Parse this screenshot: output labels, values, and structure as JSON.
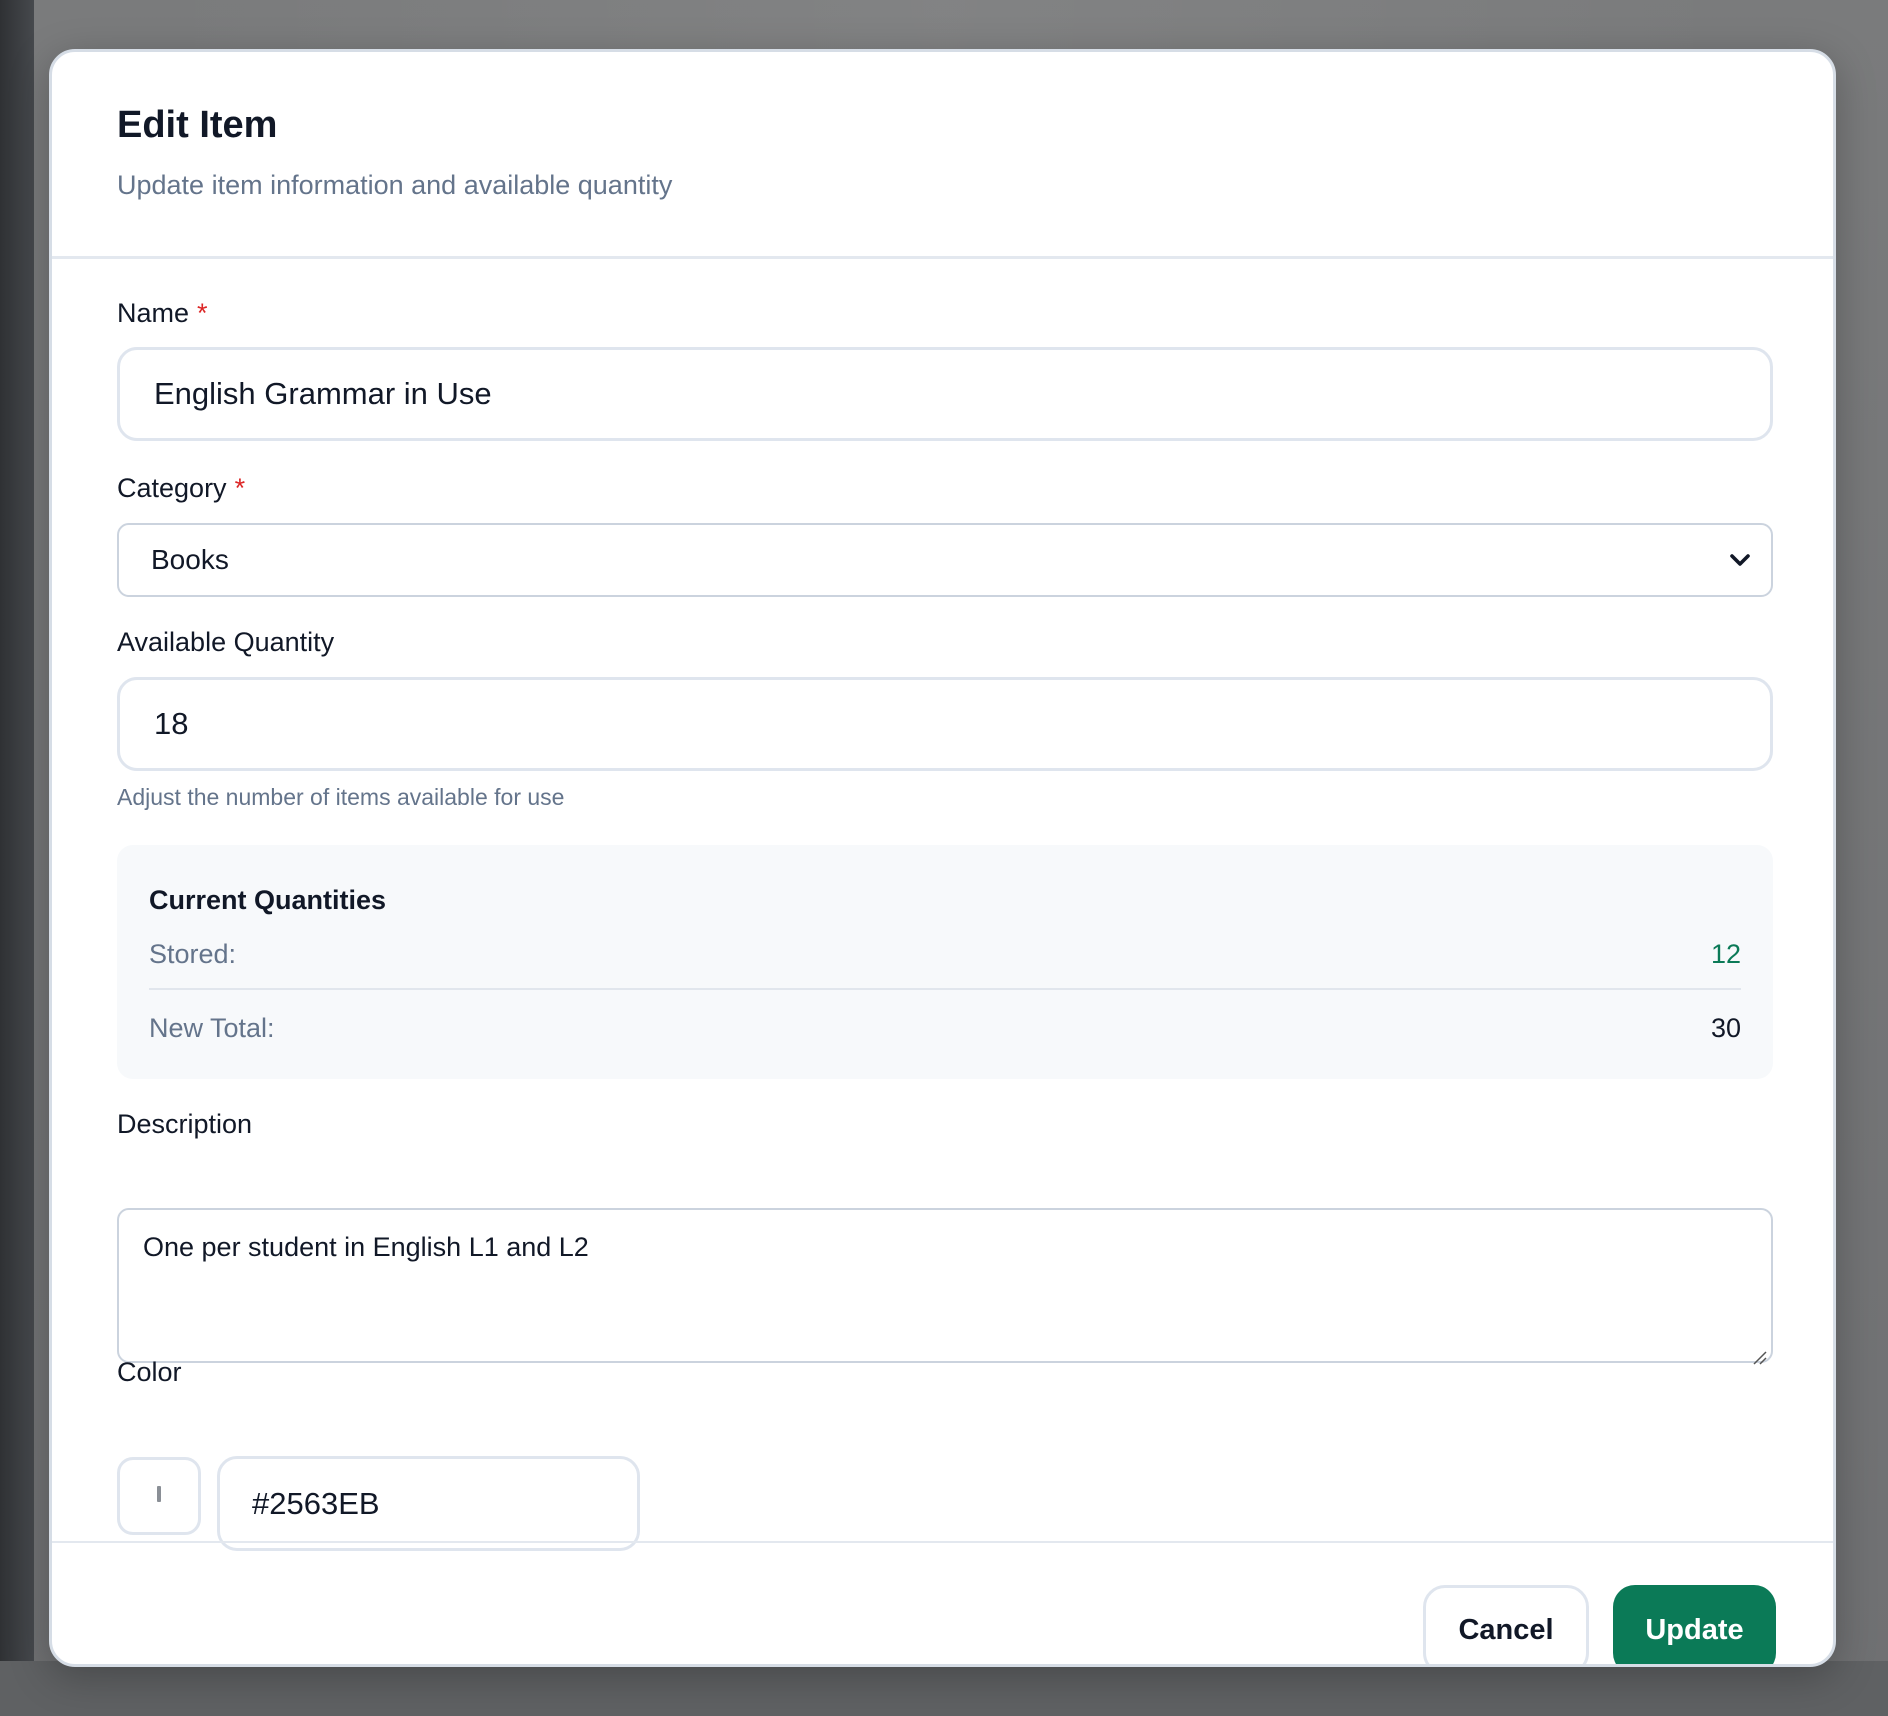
{
  "dialog": {
    "title": "Edit Item",
    "subtitle": "Update item information and available quantity"
  },
  "form": {
    "name": {
      "label": "Name",
      "required_marker": "*",
      "value": "English Grammar in Use"
    },
    "category": {
      "label": "Category",
      "required_marker": "*",
      "selected": "Books"
    },
    "available_quantity": {
      "label": "Available Quantity",
      "value": "18",
      "help": "Adjust the number of items available for use"
    },
    "current_quantities": {
      "title": "Current Quantities",
      "stored_label": "Stored:",
      "stored_value": "12",
      "new_total_label": "New Total:",
      "new_total_value": "30"
    },
    "description": {
      "label": "Description",
      "value": "One per student in English L1 and L2"
    },
    "color": {
      "label": "Color",
      "value": "#2563EB"
    }
  },
  "footer": {
    "cancel_label": "Cancel",
    "update_label": "Update"
  },
  "colors": {
    "primary_button": "#0b7a57",
    "stored_value": "#0b7a57",
    "required": "#dc2626"
  },
  "icons": {
    "select_chevron": "chevron-down-icon",
    "textarea_resize": "resize-grip-icon"
  }
}
